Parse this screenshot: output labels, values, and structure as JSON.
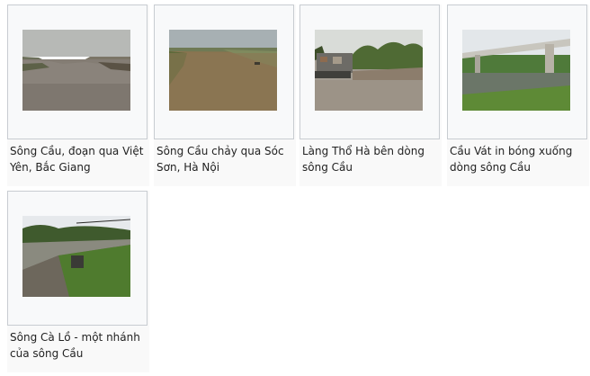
{
  "gallery": {
    "items": [
      {
        "caption": "Sông Cầu, đoạn qua Việt Yên, Bắc Giang",
        "alt": "Sông Cầu, đoạn qua Việt Yên, Bắc Giang"
      },
      {
        "caption": "Sông Cầu chảy qua Sóc Sơn, Hà Nội",
        "alt": "Sông Cầu chảy qua Sóc Sơn, Hà Nội"
      },
      {
        "caption": "Làng Thổ Hà bên dòng sông Cầu",
        "alt": "Làng Thổ Hà bên dòng sông Cầu"
      },
      {
        "caption": "Cầu Vát in bóng xuống dòng sông Cầu",
        "alt": "Cầu Vát in bóng xuống dòng sông Cầu"
      },
      {
        "caption": "Sông Cà Lồ - một nhánh của sông Cầu",
        "alt": "Sông Cà Lồ - một nhánh của sông Cầu"
      }
    ]
  }
}
